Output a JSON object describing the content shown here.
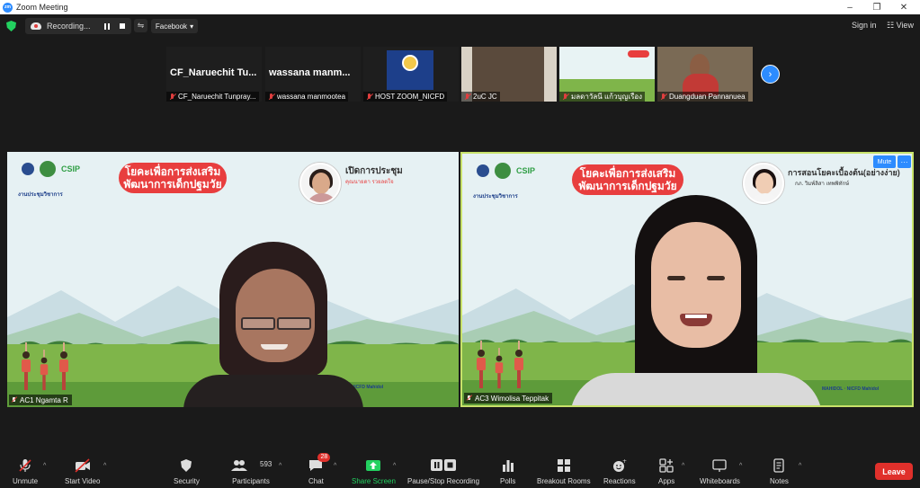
{
  "window": {
    "title": "Zoom Meeting",
    "minimize": "–",
    "restore": "❐",
    "close": "✕"
  },
  "topbar": {
    "recording_label": "Recording...",
    "stream_target": "Facebook",
    "stream_caret": "▾",
    "signin_label": "Sign in",
    "view_label": "View"
  },
  "thumbnails": [
    {
      "big_name": "CF_Naruechit Tu...",
      "label": "CF_Naruechit Tunpray..."
    },
    {
      "big_name": "wassana manm...",
      "label": "wassana manmootea"
    },
    {
      "big_name": "",
      "label": "HOST ZOOM_NICFD"
    },
    {
      "big_name": "",
      "label": "2uC JC"
    },
    {
      "big_name": "",
      "label": "มลดาวัลนี แก้วบุญเรือง"
    },
    {
      "big_name": "",
      "label": "Duangduan Pannanuea"
    }
  ],
  "thumb_next": "›",
  "panes": {
    "left": {
      "slide_title_line1": "โยคะเพื่อการส่งเสริม",
      "slide_title_line2": "พัฒนาการเด็กปฐมวัย",
      "event_label": "งานประชุมวิชาการ",
      "speaker_title": "เปิดการประชุม",
      "speaker_name": "คุณนายดา รวยลดใจ",
      "footer": "MAHIDOL   ·  NICFD Mahidol",
      "name_tag": "AC1 Ngamta R"
    },
    "right": {
      "slide_title_line1": "โยคะเพื่อการส่งเสริม",
      "slide_title_line2": "พัฒนาการเด็กปฐมวัย",
      "event_label": "งานประชุมวิชาการ",
      "speaker_title": "การสอนโยคะเบื้องต้น(อย่างง่าย)",
      "speaker_name": "กภ. วิมพ์ลิสา เทพพิทักษ์",
      "footer": "MAHIDOL   ·  NICFD Mahidol",
      "name_tag": "AC3 Wimolisa Teppitak",
      "mute_label": "Mute",
      "more_label": "···"
    }
  },
  "toolbar": {
    "unmute": "Unmute",
    "start_video": "Start Video",
    "security": "Security",
    "participants": "Participants",
    "participant_count": "593",
    "chat": "Chat",
    "chat_badge": "28",
    "share_screen": "Share Screen",
    "record": "Pause/Stop Recording",
    "polls": "Polls",
    "breakout": "Breakout Rooms",
    "reactions": "Reactions",
    "apps": "Apps",
    "whiteboards": "Whiteboards",
    "notes": "Notes",
    "leave": "Leave",
    "caret": "^"
  },
  "colors": {
    "accent": "#2d8cff",
    "leave": "#e0302b",
    "share": "#23d160",
    "active_border": "#c8e26a",
    "slide_red": "#e83e3e"
  }
}
